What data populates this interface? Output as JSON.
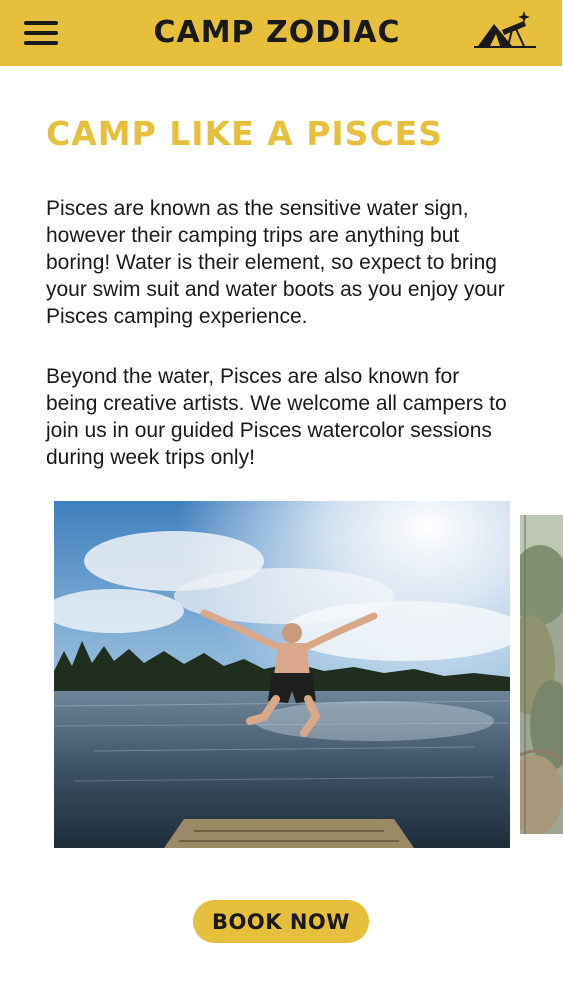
{
  "header": {
    "brand": "CAMP ZODIAC",
    "menu_icon": "hamburger-menu-icon",
    "logo_icon": "tent-telescope-icon",
    "background_color": "#e6bf3d"
  },
  "main": {
    "title": "CAMP LIKE A PISCES",
    "paragraphs": [
      "Pisces are known as the sensitive water sign, however their camping trips are anything but boring! Water is their element, so expect to bring your swim suit and water boots as you enjoy your Pisces camping experience.",
      "Beyond the water, Pisces are also known for being creative artists. We welcome all campers to join us in our guided Pisces watercolor sessions during week trips only!"
    ],
    "title_color": "#e6bf3d"
  },
  "carousel": {
    "main_image": "man-jumping-into-lake-photo",
    "next_image": "forest-trees-photo"
  },
  "cta": {
    "book_label": "BOOK NOW",
    "color": "#e6bf3d"
  }
}
